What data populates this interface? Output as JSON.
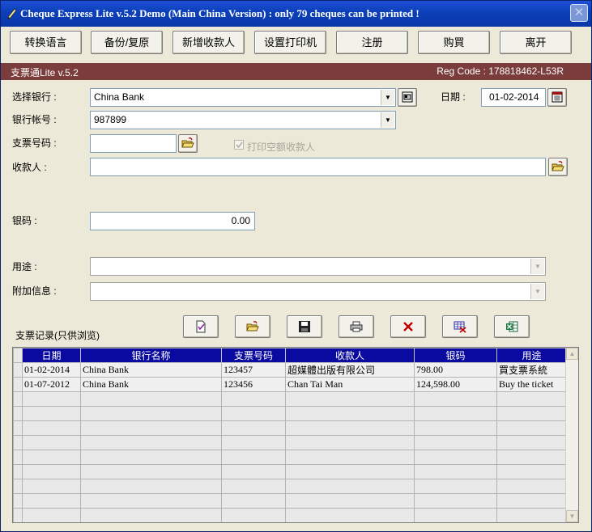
{
  "window": {
    "title": "Cheque Express Lite v.5.2 Demo (Main China Version) : only 79 cheques can be printed !",
    "close_label": "✕"
  },
  "toolbar": {
    "buttons": [
      "转换语言",
      "备份/复原",
      "新增收款人",
      "设置打印机",
      "注册",
      "购買",
      "离开"
    ]
  },
  "infobar": {
    "version": "支票通Lite v.5.2",
    "reg_code": "Reg Code : 178818462-L53R"
  },
  "form": {
    "bank_label": "选择银行 :",
    "bank_value": "China Bank",
    "date_label": "日期 :",
    "date_value": "01-02-2014",
    "account_label": "银行帐号 :",
    "account_value": "987899",
    "cheque_no_label": "支票号码 :",
    "cheque_no_value": "",
    "print_payee_label": "打印空额收款人",
    "payee_label": "收款人 :",
    "payee_value": "",
    "amount_label": "银码 :",
    "amount_value": "0.00",
    "purpose_label": "用途 :",
    "purpose_value": "",
    "extra_label": "附加信息 :",
    "extra_value": ""
  },
  "records": {
    "section_label": "支票记录(只供浏览)",
    "columns": [
      "日期",
      "银行名称",
      "支票号码",
      "收款人",
      "银码",
      "用途"
    ],
    "rows": [
      [
        "01-02-2014",
        "China Bank",
        "123457",
        "超媒體出版有限公司",
        "798.00",
        "買支票系統"
      ],
      [
        "01-07-2012",
        "China Bank",
        "123456",
        "Chan Tai Man",
        "124,598.00",
        "Buy the ticket"
      ]
    ],
    "empty_rows": 9
  },
  "colors": {
    "title_bar": "#0a37a8",
    "info_bar": "#7b3c3c",
    "grid_header": "#0a0aa0",
    "window_bg": "#ece9d8"
  },
  "icons": {
    "title": "pen-icon",
    "bank_card": "card-icon",
    "calendar": "calendar-icon",
    "folder": "open-folder-icon",
    "toolbar": [
      "edit-document-icon",
      "open-folder-icon",
      "save-disk-icon",
      "printer-icon",
      "delete-x-icon",
      "delete-table-icon",
      "excel-icon"
    ]
  }
}
